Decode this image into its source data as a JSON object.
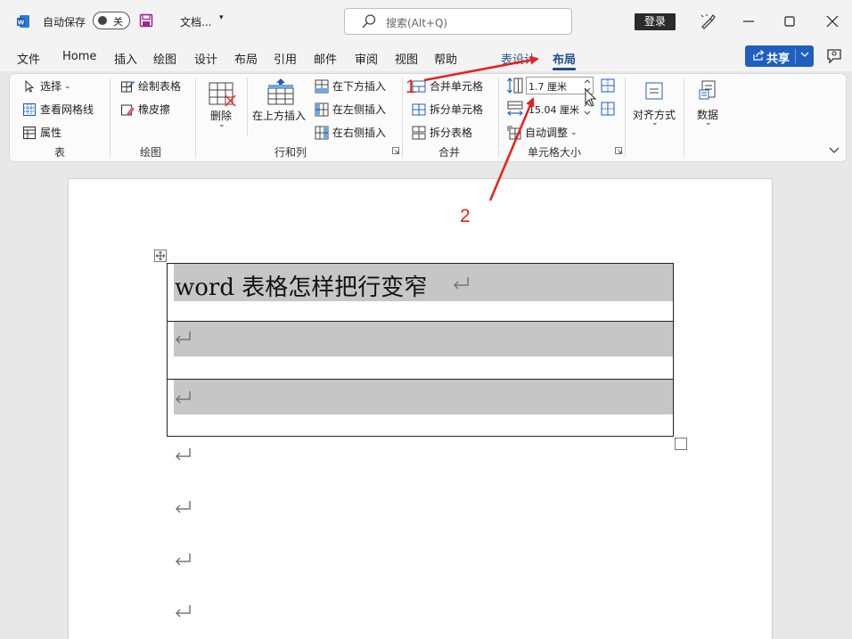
{
  "titlebar": {
    "autosave_label": "自动保存",
    "autosave_state": "关",
    "doc_name": "文档...",
    "search_placeholder": "搜索(Alt+Q)",
    "login_label": "登录"
  },
  "menu": {
    "tabs": [
      "文件",
      "Home",
      "插入",
      "绘图",
      "设计",
      "布局",
      "引用",
      "邮件",
      "审阅",
      "视图",
      "帮助"
    ],
    "context_tabs": [
      "表设计",
      "布局"
    ],
    "active_tab": "布局",
    "share_label": "共享"
  },
  "ribbon": {
    "groups": {
      "table": {
        "label": "表",
        "select": "选择",
        "view_gridlines": "查看网格线",
        "properties": "属性"
      },
      "draw": {
        "label": "绘图",
        "draw_table": "绘制表格",
        "eraser": "橡皮擦"
      },
      "rows_cols": {
        "label": "行和列",
        "delete": "删除",
        "insert_above": "在上方插入",
        "insert_below": "在下方插入",
        "insert_left": "在左侧插入",
        "insert_right": "在右侧插入"
      },
      "merge": {
        "label": "合并",
        "merge_cells": "合并单元格",
        "split_cells": "拆分单元格",
        "split_table": "拆分表格"
      },
      "cell_size": {
        "label": "单元格大小",
        "height_value": "1.7 厘米",
        "width_value": "15.04 厘米",
        "autofit": "自动调整"
      },
      "alignment": {
        "label": "对齐方式"
      },
      "data": {
        "label": "数据"
      }
    }
  },
  "document": {
    "table": {
      "rows": [
        "word 表格怎样把行变窄",
        "",
        ""
      ]
    },
    "empty_paragraphs": 4
  },
  "annotations": {
    "labels": [
      "1",
      "2"
    ],
    "color": "#e8201c"
  },
  "colors": {
    "accent": "#1e4e8c",
    "share_button": "#1f5fbf",
    "highlight": "#c6c6c6"
  }
}
